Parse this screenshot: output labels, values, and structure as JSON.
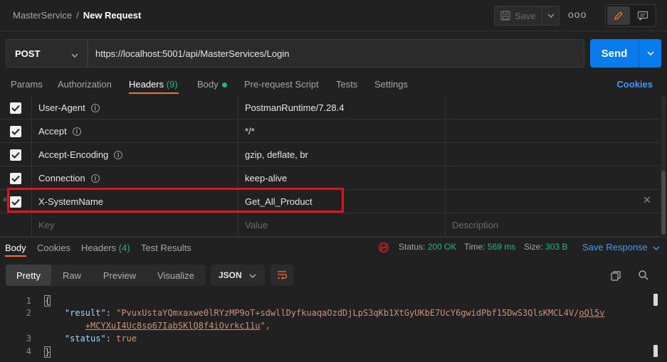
{
  "breadcrumb": {
    "collection": "MasterService",
    "separator": "/",
    "request": "New Request"
  },
  "toolbar": {
    "save_label": "Save",
    "more_label": "ooo"
  },
  "request": {
    "method": "POST",
    "url": "https://localhost:5001/api/MasterServices/Login",
    "send_label": "Send"
  },
  "tabs": {
    "params": "Params",
    "authorization": "Authorization",
    "headers": "Headers",
    "headers_count": "(9)",
    "body": "Body",
    "prerequest": "Pre-request Script",
    "tests": "Tests",
    "settings": "Settings",
    "cookies": "Cookies"
  },
  "headers": [
    {
      "key": "User-Agent",
      "value": "PostmanRuntime/7.28.4",
      "info": true
    },
    {
      "key": "Accept",
      "value": "*/*",
      "info": true
    },
    {
      "key": "Accept-Encoding",
      "value": "gzip, deflate, br",
      "info": true
    },
    {
      "key": "Connection",
      "value": "keep-alive",
      "info": true
    },
    {
      "key": "X-SystemName",
      "value": "Get_All_Product",
      "info": false
    }
  ],
  "new_row": {
    "key_placeholder": "Key",
    "value_placeholder": "Value",
    "desc_placeholder": "Description"
  },
  "response_tabs": {
    "body": "Body",
    "cookies": "Cookies",
    "headers": "Headers",
    "headers_count": "(4)",
    "test_results": "Test Results"
  },
  "status": {
    "status_label": "Status:",
    "status_value": "200 OK",
    "time_label": "Time:",
    "time_value": "569 ms",
    "size_label": "Size:",
    "size_value": "303 B",
    "save_response": "Save Response"
  },
  "format": {
    "pretty": "Pretty",
    "raw": "Raw",
    "preview": "Preview",
    "visualize": "Visualize",
    "type": "JSON"
  },
  "code": {
    "line_numbers": [
      "1",
      "2",
      "3",
      "4"
    ],
    "open_brace": "{",
    "close_brace": "}",
    "result_key": "\"result\"",
    "result_value_1": "\"PvuxUstaYQmxaxwe0lRYzMP9oT+sdwllDyfkuaqaOzdDjLpS3qKb1XtGyUKbE7UcY6gwidPbf15DwS3QlsKMCL4V/",
    "result_value_1_link": "oQl5v",
    "result_value_2_link": "+MCYXuI4Uc8sp67IabSKlQ8f4iOvrkc11u",
    "result_value_2_tail": "\",",
    "status_key": "\"status\"",
    "status_value": "true"
  },
  "colors": {
    "accent": "#ff6c37",
    "send": "#097bed",
    "ok": "#26b47f",
    "highlight": "#e0141e"
  }
}
